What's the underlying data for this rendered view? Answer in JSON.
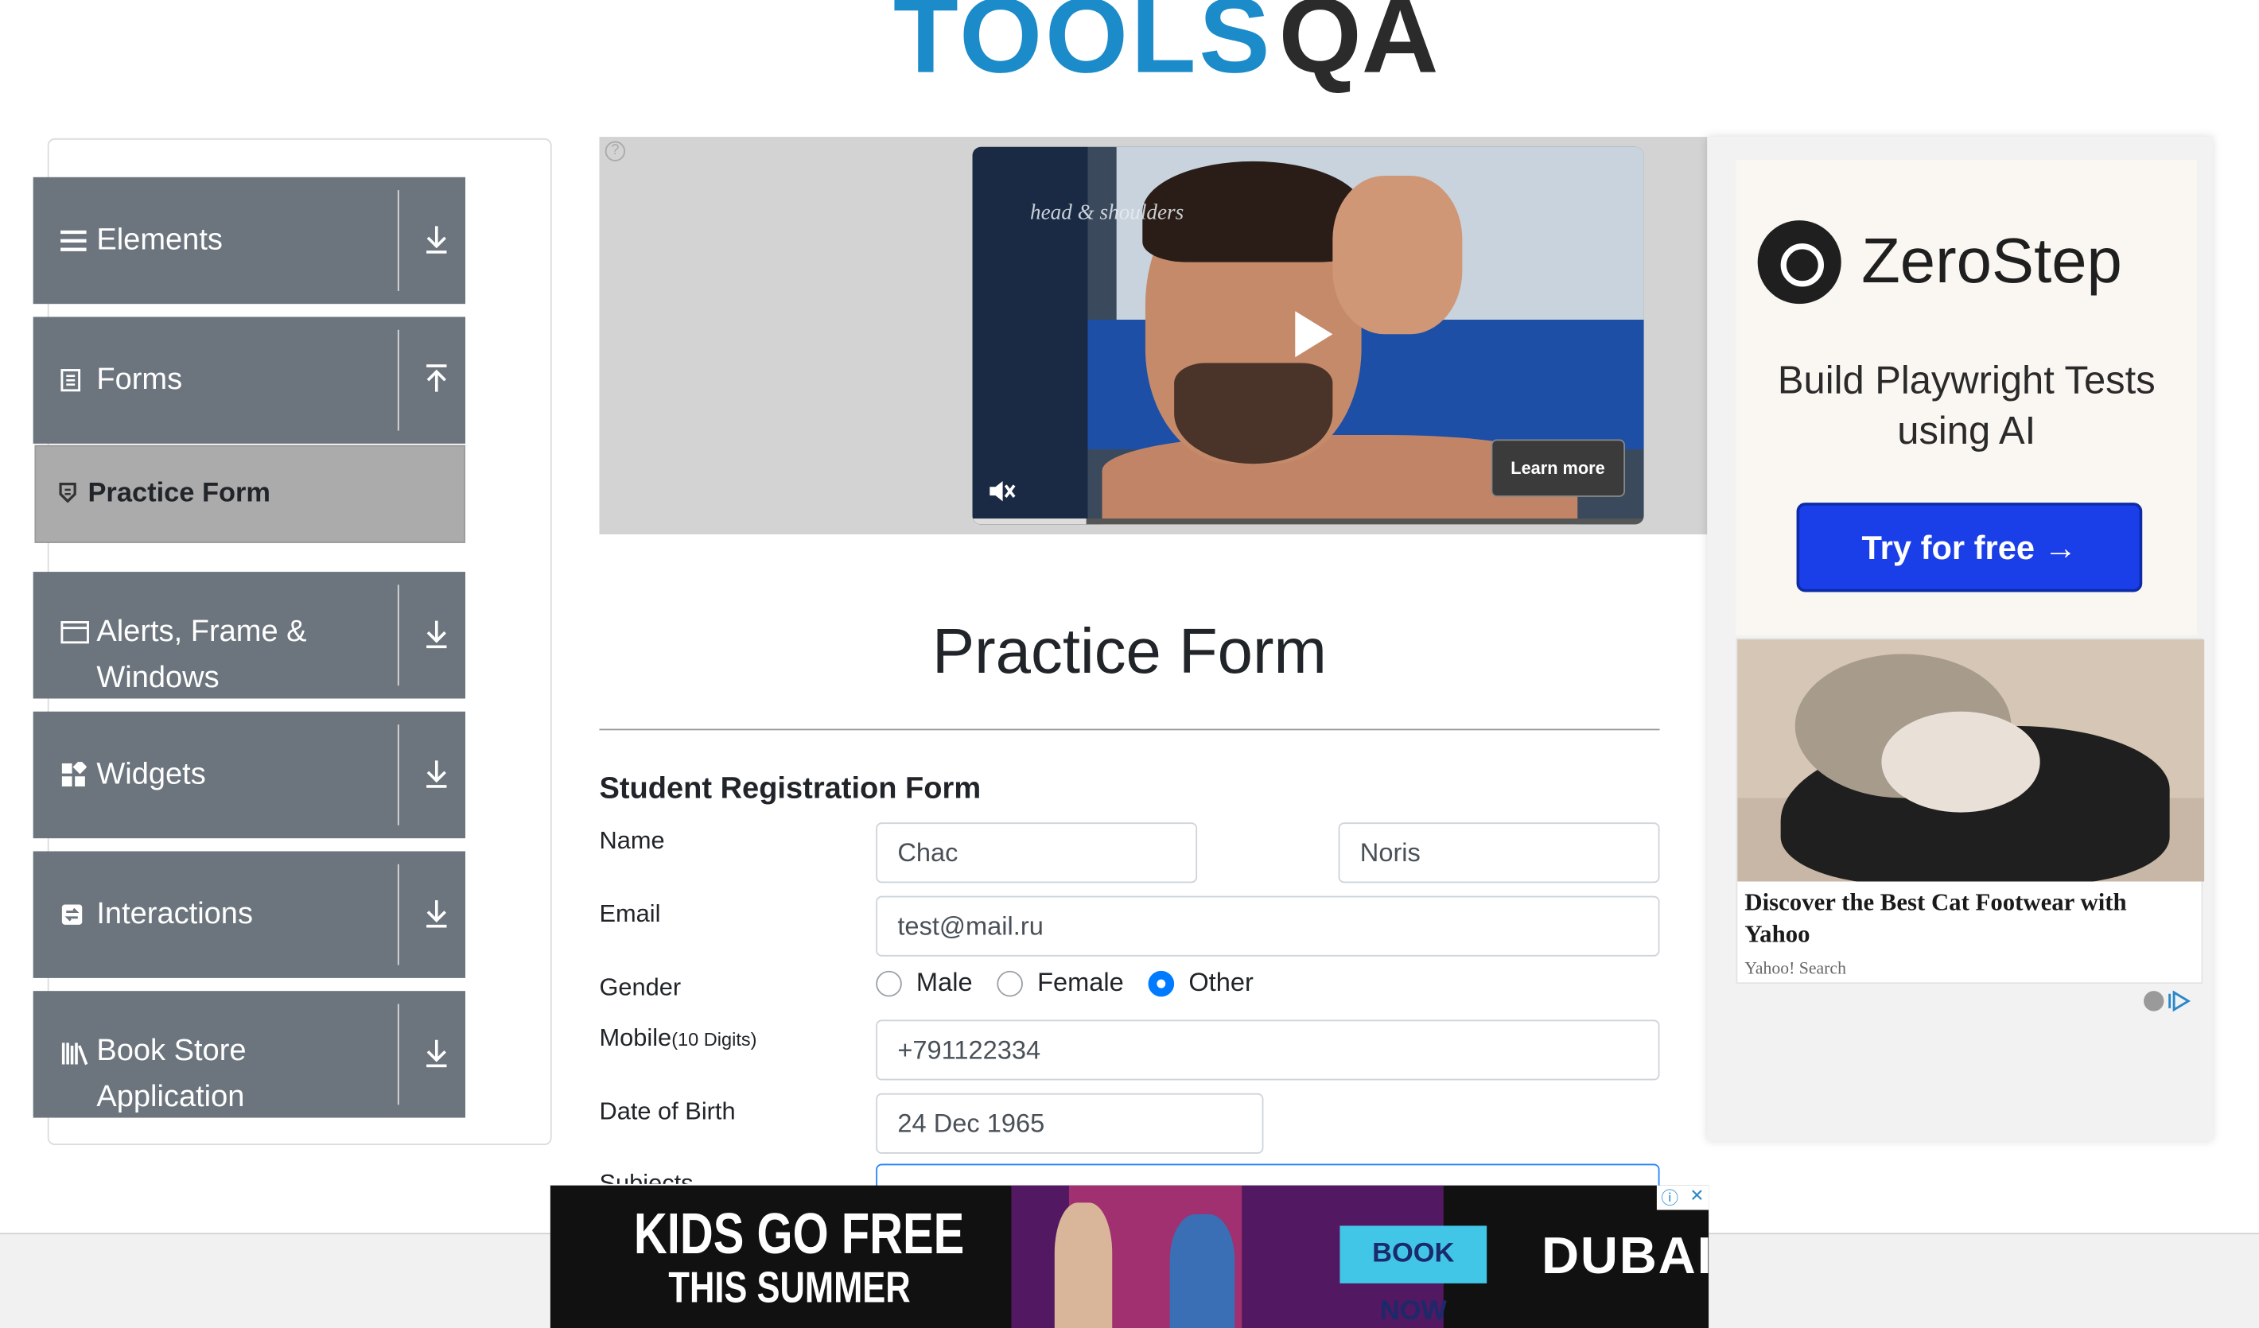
{
  "logo": {
    "part1": "TOOLS",
    "part2": "QA"
  },
  "sidebar": {
    "groups": [
      {
        "label": "Elements",
        "icon": "hamburger-icon",
        "arrow": "download-arrow-icon"
      },
      {
        "label": "Forms",
        "icon": "document-icon",
        "arrow": "upload-arrow-icon"
      },
      {
        "label": "Alerts, Frame & Windows",
        "icon": "window-icon",
        "arrow": "download-arrow-icon"
      },
      {
        "label": "Widgets",
        "icon": "widgets-icon",
        "arrow": "download-arrow-icon"
      },
      {
        "label": "Interactions",
        "icon": "interactions-icon",
        "arrow": "download-arrow-icon"
      },
      {
        "label": "Book Store Application",
        "icon": "books-icon",
        "arrow": "download-arrow-icon"
      }
    ],
    "active_item": "Practice Form"
  },
  "video_ad": {
    "brand": "head & shoulders",
    "learn_more": "Learn more",
    "progress": 0.17
  },
  "form": {
    "page_title": "Practice Form",
    "section_title": "Student Registration Form",
    "name_label": "Name",
    "first_name": "Chac",
    "last_name": "Noris",
    "email_label": "Email",
    "email": "test@mail.ru",
    "gender_label": "Gender",
    "gender_options": [
      "Male",
      "Female",
      "Other"
    ],
    "gender_selected": "Other",
    "mobile_label": "Mobile",
    "mobile_hint": "(10 Digits)",
    "mobile": "+791122334",
    "dob_label": "Date of Birth",
    "dob": "24 Dec 1965",
    "subjects_label": "Subjects"
  },
  "right_ad": {
    "brand": "ZeroStep",
    "tagline": "Build Playwright Tests using AI",
    "cta": "Try for free →",
    "card_title": "Discover the Best Cat Footwear with Yahoo",
    "card_source": "Yahoo! Search"
  },
  "bottom_ad": {
    "headline1": "KIDS GO FREE",
    "headline2": "THIS SUMMER",
    "cta": "BOOK NOW",
    "brand": "DUBAI"
  }
}
